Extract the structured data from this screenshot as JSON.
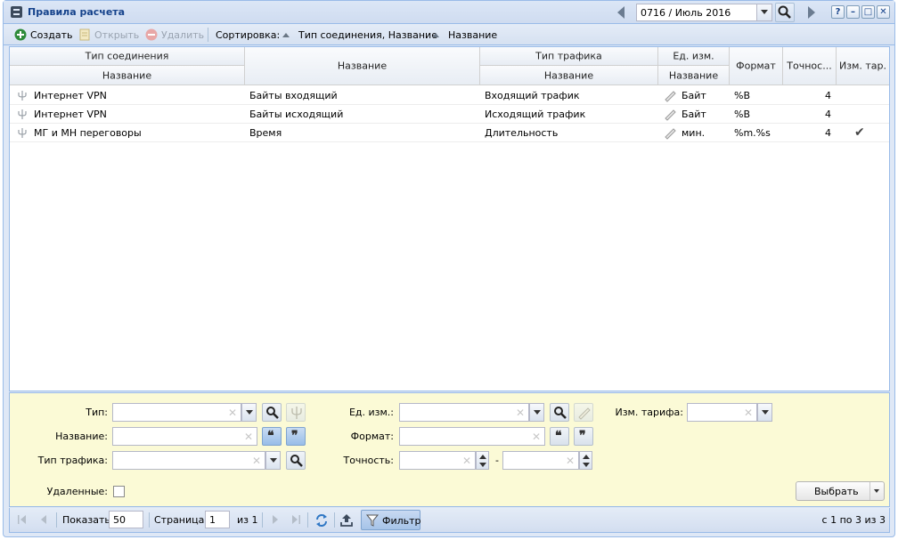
{
  "window": {
    "title": "Правила расчета",
    "period_value": "0716 / Июль 2016",
    "help_glyph": "?",
    "minimize_glyph": "–",
    "maximize_glyph": "□",
    "close_glyph": "✕"
  },
  "toolbar": {
    "create_label": "Создать",
    "open_label": "Открыть",
    "delete_label": "Удалить",
    "sort_label": "Сортировка:",
    "sort_items": [
      "Тип соединения, Название",
      "Название"
    ]
  },
  "grid": {
    "group_headers": {
      "connection_type": "Тип соединения",
      "traffic_type": "Тип трафика",
      "unit": "Ед. изм."
    },
    "columns": {
      "connection_name": "Название",
      "name": "Название",
      "traffic_name": "Название",
      "unit_name": "Название",
      "format": "Формат",
      "precision": "Точнос...",
      "tariff_change": "Изм. тар."
    },
    "rows": [
      {
        "connection": "Интернет VPN",
        "name": "Байты входящий",
        "traffic": "Входящий трафик",
        "unit": "Байт",
        "format": "%B",
        "precision": "4",
        "tariff_change": ""
      },
      {
        "connection": "Интернет VPN",
        "name": "Байты исходящий",
        "traffic": "Исходящий трафик",
        "unit": "Байт",
        "format": "%B",
        "precision": "4",
        "tariff_change": ""
      },
      {
        "connection": "МГ и МН переговоры",
        "name": "Время",
        "traffic": "Длительность",
        "unit": "мин.",
        "format": "%m.%s",
        "precision": "4",
        "tariff_change": "✔"
      }
    ]
  },
  "filter": {
    "type_label": "Тип:",
    "name_label": "Название:",
    "traffic_label": "Тип трафика:",
    "deleted_label": "Удаленные:",
    "unit_label": "Ед. изм.:",
    "format_label": "Формат:",
    "precision_label": "Точность:",
    "precision_dash": "-",
    "tariff_label": "Изм. тарифа:",
    "clear_glyph": "✕",
    "open_quote": "❝",
    "close_quote": "❞",
    "select_button": "Выбрать"
  },
  "paging": {
    "show_label": "Показать",
    "page_size": "50",
    "page_label": "Страница",
    "page_value": "1",
    "of_label": "из 1",
    "filter_label": "Фильтр",
    "summary": "с 1 по 3 из 3"
  },
  "colors": {
    "header_text": "#15428b",
    "filter_bg": "#fbfad6",
    "border": "#99bbe8"
  }
}
